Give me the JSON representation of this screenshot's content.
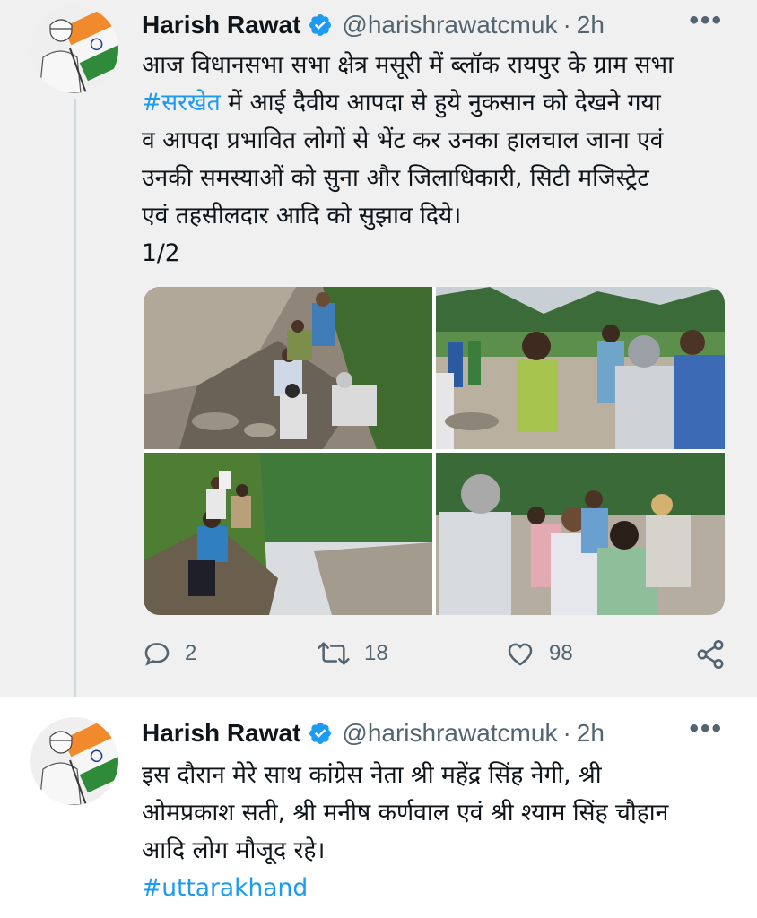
{
  "tweets": [
    {
      "author_name": "Harish Rawat",
      "handle": "@harishrawatcmuk",
      "separator": "·",
      "time": "2h",
      "more_icon": "more-horizontal-icon",
      "verified_icon": "verified-badge-icon",
      "text_lines": [
        "आज विधानसभा सभा क्षेत्र मसूरी में ब्लॉक रायपुर के ग्राम सभा",
        "में आई दैवीय आपदा से हुये नुकसान को देखने गया",
        "व आपदा प्रभावित लोगों से भेंट कर उनका हालचाल जाना एवं",
        "उनकी समस्याओं को सुना और जिलाधिकारी, सिटी मजिस्ट्रेट",
        "एवं तहसीलदार आदि को सुझाव दिये।",
        "1/2"
      ],
      "hashtag": "#सरखेत",
      "actions": {
        "reply_count": "2",
        "retweet_count": "18",
        "like_count": "98"
      }
    },
    {
      "author_name": "Harish Rawat",
      "handle": "@harishrawatcmuk",
      "separator": "·",
      "time": "2h",
      "text_lines": [
        "इस दौरान मेरे साथ कांग्रेस नेता श्री महेंद्र सिंह नेगी, श्री",
        "ओमप्रकाश सती, श्री मनीष कर्णवाल एवं श्री श्याम सिंह चौहान",
        "आदि लोग मौजूद रहे।"
      ],
      "hashtag": "#uttarakhand"
    }
  ],
  "colors": {
    "accent": "#1d9bf0",
    "secondary_text": "#536471",
    "primary_text": "#0f1419",
    "thread_line": "#cfd9de"
  },
  "icons": [
    "reply-icon",
    "retweet-icon",
    "like-icon",
    "share-icon"
  ]
}
